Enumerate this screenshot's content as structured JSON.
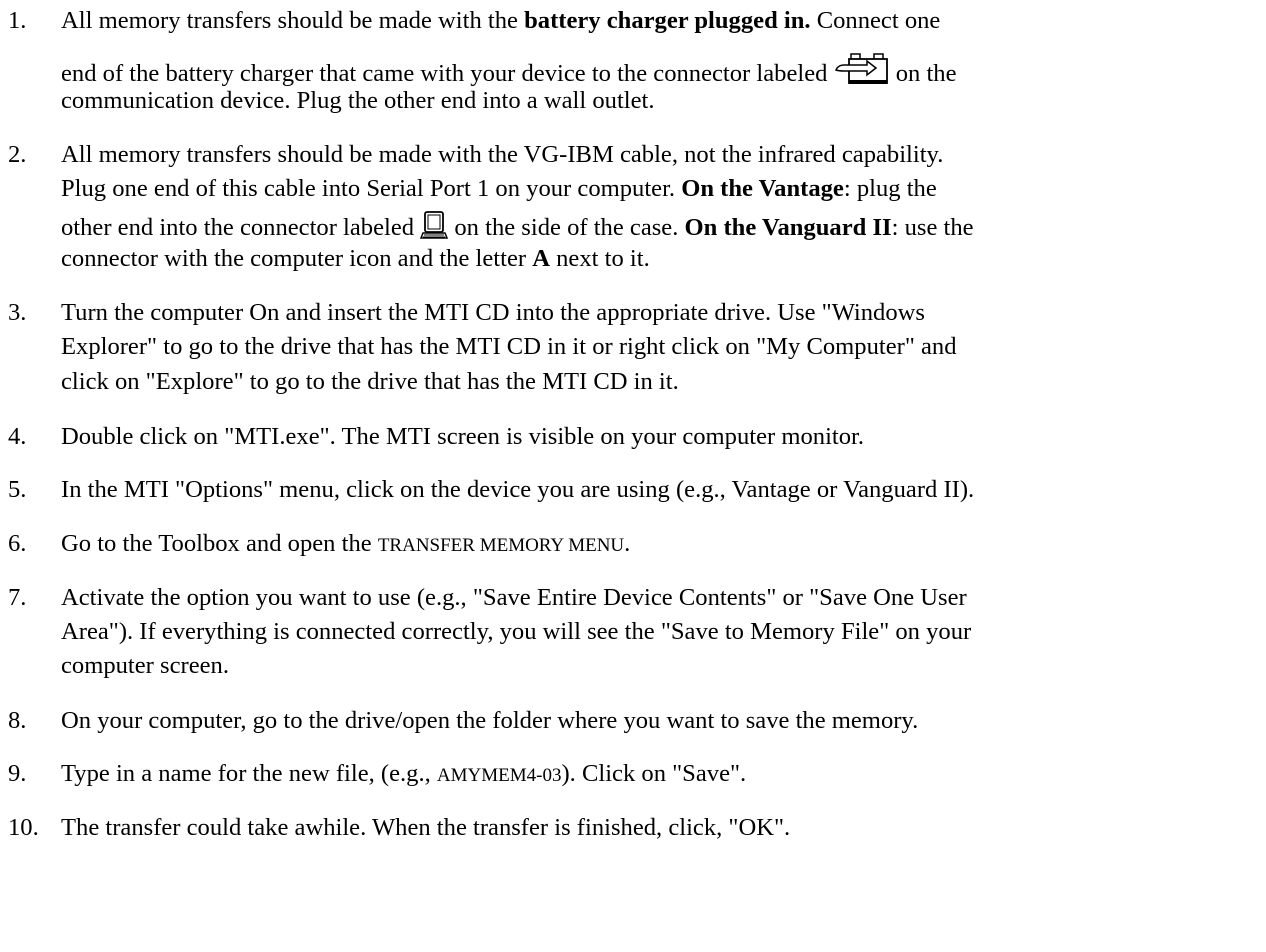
{
  "steps": [
    {
      "num": "1.",
      "line1_a": "All memory transfers should be made with the ",
      "line1_bold": "battery charger plugged in.",
      "line1_b": "  Connect one",
      "line2_a": "end of the battery charger that came with your device to the connector labeled ",
      "line2_b": " on the",
      "line3": "communication device.  Plug the other end into a wall outlet."
    },
    {
      "num": "2.",
      "line1": "All memory transfers should be made with the VG-IBM cable, not the infrared capability.",
      "line2_a": "Plug one end of this cable into Serial Port 1 on your computer.  ",
      "line2_bold": "On the Vantage",
      "line2_b": ": plug the",
      "line3_a": "other end into the connector labeled ",
      "line3_b": " on the side of the case.  ",
      "line3_bold": "On the Vanguard II",
      "line3_c": ": use the",
      "line4_a": "connector with the computer icon and the letter ",
      "line4_bold": "A",
      "line4_b": " next to it."
    },
    {
      "num": "3.",
      "line1": "Turn the computer On and insert the MTI CD into the appropriate drive.  Use \"Windows",
      "line2": "Explorer\" to go to the drive that has the MTI CD in it or right click on \"My Computer\" and",
      "line3": "click on \"Explore\" to go to the drive that has the MTI CD in it."
    },
    {
      "num": "4.",
      "line1": "Double click on \"MTI.exe\".  The MTI screen is visible on your computer monitor."
    },
    {
      "num": "5.",
      "line1": "In the MTI \"Options\" menu, click on the device you are using (e.g., Vantage or Vanguard II)."
    },
    {
      "num": "6.",
      "line1_a": "Go to the Toolbox and open the ",
      "line1_sc": "TRANSFER MEMORY MENU",
      "line1_b": "."
    },
    {
      "num": "7.",
      "line1": "Activate the option you want to use (e.g., \"Save Entire Device Contents\" or \"Save One User",
      "line2": "Area\").  If everything is connected correctly, you will see the \"Save to Memory File\" on your",
      "line3": "computer screen."
    },
    {
      "num": "8.",
      "line1": "On your computer, go to the drive/open the folder where you want to save the memory."
    },
    {
      "num": "9.",
      "line1_a": "Type in a name for the new file, (e.g., ",
      "line1_sc": "AMYMEM4-03",
      "line1_b": ").  Click on \"Save\"."
    },
    {
      "num": "10.",
      "line1": "The transfer could take awhile.  When the transfer is finished, click, \"OK\"."
    }
  ],
  "icons": [
    "battery-charger-icon",
    "computer-port-icon"
  ]
}
